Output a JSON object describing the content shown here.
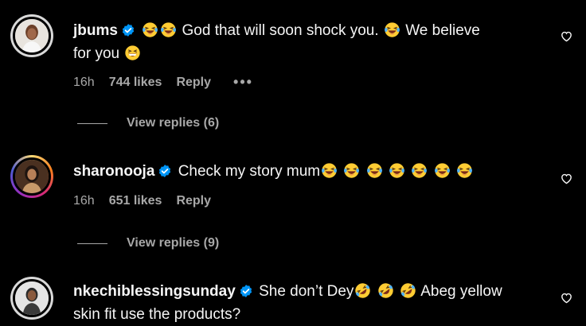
{
  "comments": [
    {
      "username": "jbums",
      "text_parts": [
        "God that will soon shock you.",
        "We believe",
        "for you"
      ],
      "time": "16h",
      "likes": "744 likes",
      "reply_label": "Reply",
      "more_label": "•••",
      "view_replies": "View replies (6)"
    },
    {
      "username": "sharonooja",
      "text_parts": [
        "Check my story mum"
      ],
      "time": "16h",
      "likes": "651 likes",
      "reply_label": "Reply",
      "view_replies": "View replies (9)"
    },
    {
      "username": "nkechiblessingsunday",
      "text_parts": [
        "She don’t Dey",
        "Abeg yellow",
        "skin fit use the products?"
      ]
    }
  ],
  "icons": {
    "verified": "verified-badge-icon",
    "laugh": "face-with-tears-of-joy-emoji",
    "grin": "grinning-squinting-face-emoji",
    "rofl": "rolling-on-floor-laughing-emoji",
    "heart": "heart-outline-icon"
  },
  "colors": {
    "background": "#000000",
    "text": "#f5f5f5",
    "secondary": "#a8a8a8",
    "verified": "#0095f6"
  }
}
